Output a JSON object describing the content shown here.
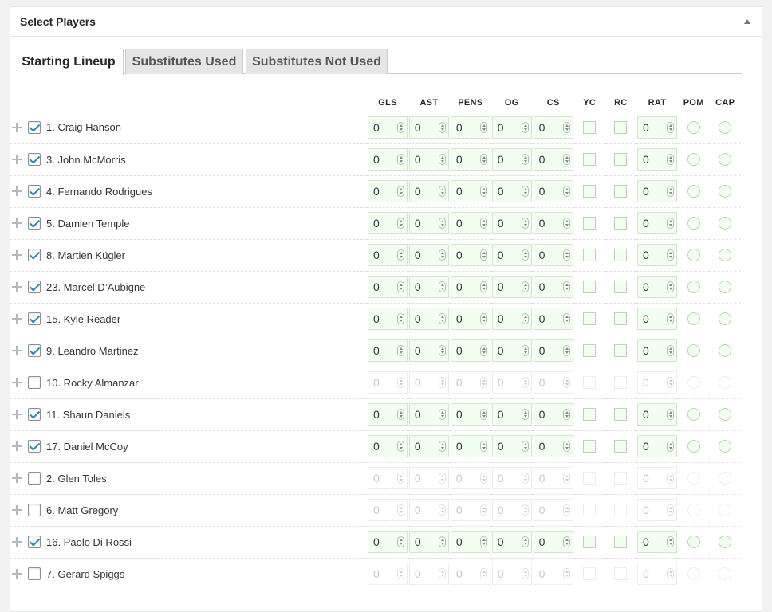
{
  "panel": {
    "title": "Select Players"
  },
  "tabs": [
    {
      "label": "Starting Lineup",
      "active": true
    },
    {
      "label": "Substitutes Used",
      "active": false
    },
    {
      "label": "Substitutes Not Used",
      "active": false
    }
  ],
  "columns": [
    "GLS",
    "AST",
    "PENS",
    "OG",
    "CS",
    "YC",
    "RC",
    "RAT",
    "POM",
    "CAP"
  ],
  "players": [
    {
      "name": "1. Craig Hanson",
      "checked": true,
      "gls": "0",
      "ast": "0",
      "pens": "0",
      "og": "0",
      "cs": "0",
      "rat": "0"
    },
    {
      "name": "3. John McMorris",
      "checked": true,
      "gls": "0",
      "ast": "0",
      "pens": "0",
      "og": "0",
      "cs": "0",
      "rat": "0"
    },
    {
      "name": "4. Fernando Rodrigues",
      "checked": true,
      "gls": "0",
      "ast": "0",
      "pens": "0",
      "og": "0",
      "cs": "0",
      "rat": "0"
    },
    {
      "name": "5. Damien Temple",
      "checked": true,
      "gls": "0",
      "ast": "0",
      "pens": "0",
      "og": "0",
      "cs": "0",
      "rat": "0"
    },
    {
      "name": "8. Martien Kügler",
      "checked": true,
      "gls": "0",
      "ast": "0",
      "pens": "0",
      "og": "0",
      "cs": "0",
      "rat": "0"
    },
    {
      "name": "23. Marcel D’Aubigne",
      "checked": true,
      "gls": "0",
      "ast": "0",
      "pens": "0",
      "og": "0",
      "cs": "0",
      "rat": "0"
    },
    {
      "name": "15. Kyle Reader",
      "checked": true,
      "gls": "0",
      "ast": "0",
      "pens": "0",
      "og": "0",
      "cs": "0",
      "rat": "0"
    },
    {
      "name": "9. Leandro Martinez",
      "checked": true,
      "gls": "0",
      "ast": "0",
      "pens": "0",
      "og": "0",
      "cs": "0",
      "rat": "0"
    },
    {
      "name": "10. Rocky Almanzar",
      "checked": false,
      "gls": "0",
      "ast": "0",
      "pens": "0",
      "og": "0",
      "cs": "0",
      "rat": "0"
    },
    {
      "name": "11. Shaun Daniels",
      "checked": true,
      "gls": "0",
      "ast": "0",
      "pens": "0",
      "og": "0",
      "cs": "0",
      "rat": "0"
    },
    {
      "name": "17. Daniel McCoy",
      "checked": true,
      "gls": "0",
      "ast": "0",
      "pens": "0",
      "og": "0",
      "cs": "0",
      "rat": "0"
    },
    {
      "name": "2. Glen Toles",
      "checked": false,
      "gls": "0",
      "ast": "0",
      "pens": "0",
      "og": "0",
      "cs": "0",
      "rat": "0"
    },
    {
      "name": "6. Matt Gregory",
      "checked": false,
      "gls": "0",
      "ast": "0",
      "pens": "0",
      "og": "0",
      "cs": "0",
      "rat": "0"
    },
    {
      "name": "16. Paolo Di Rossi",
      "checked": true,
      "gls": "0",
      "ast": "0",
      "pens": "0",
      "og": "0",
      "cs": "0",
      "rat": "0"
    },
    {
      "name": "7. Gerard Spiggs",
      "checked": false,
      "gls": "0",
      "ast": "0",
      "pens": "0",
      "og": "0",
      "cs": "0",
      "rat": "0"
    }
  ],
  "colors": {
    "checkmark": "#1e8cbe",
    "field_bg": "#f2fff0",
    "field_border": "#d0e8c8"
  }
}
